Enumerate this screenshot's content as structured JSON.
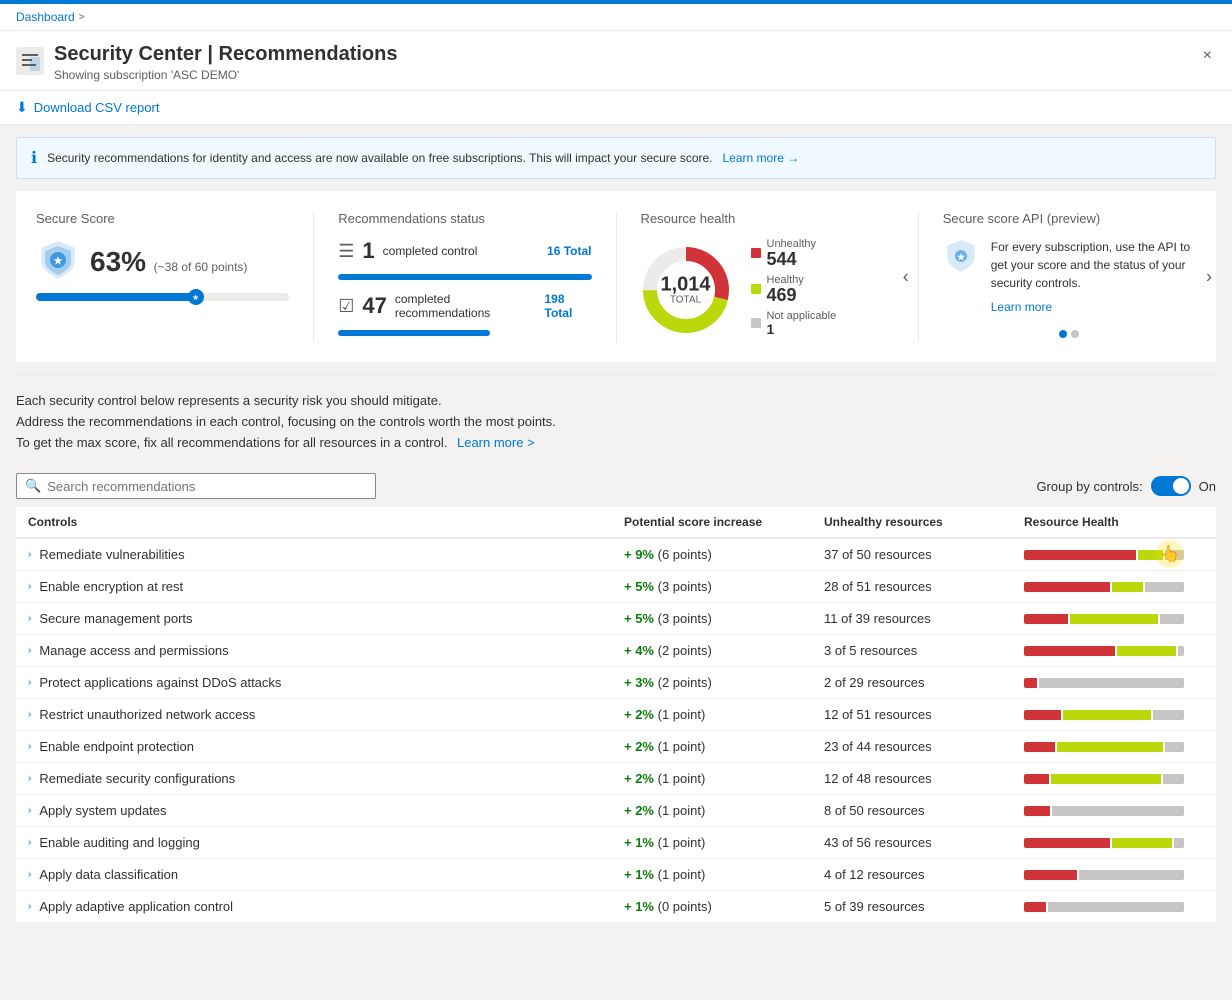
{
  "topbar": {
    "color": "#0078d4"
  },
  "breadcrumb": {
    "items": [
      "Dashboard"
    ],
    "separator": ">"
  },
  "header": {
    "icon_color": "#0078d4",
    "title": "Security Center | Recommendations",
    "subtitle": "Showing subscription 'ASC DEMO'",
    "close_label": "×"
  },
  "toolbar": {
    "download_label": "Download CSV report"
  },
  "info_banner": {
    "text": "Security recommendations for identity and access are now available on free subscriptions. This will impact your secure score.",
    "link_text": "Learn more →"
  },
  "secure_score": {
    "title": "Secure Score",
    "percent": "63%",
    "desc": "(~38 of 60 points)",
    "bar_width": "63"
  },
  "recommendations_status": {
    "title": "Recommendations status",
    "controls_count": "1",
    "controls_label": "completed control",
    "controls_total": "16 Total",
    "recs_count": "47",
    "recs_label": "completed recommendations",
    "recs_total": "198 Total"
  },
  "resource_health": {
    "title": "Resource health",
    "total": "1,014",
    "total_label": "TOTAL",
    "unhealthy_label": "Unhealthy",
    "unhealthy_count": "544",
    "healthy_label": "Healthy",
    "healthy_count": "469",
    "na_label": "Not applicable",
    "na_count": "1",
    "donut": {
      "unhealthy_pct": 54,
      "healthy_pct": 46
    }
  },
  "secure_score_api": {
    "title": "Secure score API (preview)",
    "text": "For every subscription, use the API to get your score and the status of your security controls.",
    "link_text": "Learn more",
    "dots": [
      true,
      false
    ]
  },
  "description": {
    "line1": "Each security control below represents a security risk you should mitigate.",
    "line2": "Address the recommendations in each control, focusing on the controls worth the most points.",
    "line3": "To get the max score, fix all recommendations for all resources in a control.",
    "link_text": "Learn more >"
  },
  "search": {
    "placeholder": "Search recommendations"
  },
  "group_by": {
    "label": "Group by controls:",
    "state": "On"
  },
  "table": {
    "headers": [
      "Controls",
      "Potential score increase",
      "Unhealthy resources",
      "Resource Health"
    ],
    "rows": [
      {
        "name": "Remediate vulnerabilities",
        "score": "+ 9%",
        "score_points": "(6 points)",
        "unhealthy": "37 of 50 resources",
        "red_pct": 72,
        "green_pct": 16,
        "gray_pct": 12,
        "has_cursor": true
      },
      {
        "name": "Enable encryption at rest",
        "score": "+ 5%",
        "score_points": "(3 points)",
        "unhealthy": "28 of 51 resources",
        "red_pct": 55,
        "green_pct": 20,
        "gray_pct": 25,
        "has_cursor": false
      },
      {
        "name": "Secure management ports",
        "score": "+ 5%",
        "score_points": "(3 points)",
        "unhealthy": "11 of 39 resources",
        "red_pct": 28,
        "green_pct": 56,
        "gray_pct": 16,
        "has_cursor": false
      },
      {
        "name": "Manage access and permissions",
        "score": "+ 4%",
        "score_points": "(2 points)",
        "unhealthy": "3 of 5 resources",
        "red_pct": 58,
        "green_pct": 38,
        "gray_pct": 4,
        "has_cursor": false
      },
      {
        "name": "Protect applications against DDoS attacks",
        "score": "+ 3%",
        "score_points": "(2 points)",
        "unhealthy": "2 of 29 resources",
        "red_pct": 8,
        "green_pct": 0,
        "gray_pct": 92,
        "has_cursor": false
      },
      {
        "name": "Restrict unauthorized network access",
        "score": "+ 2%",
        "score_points": "(1 point)",
        "unhealthy": "12 of 51 resources",
        "red_pct": 24,
        "green_pct": 56,
        "gray_pct": 20,
        "has_cursor": false
      },
      {
        "name": "Enable endpoint protection",
        "score": "+ 2%",
        "score_points": "(1 point)",
        "unhealthy": "23 of 44 resources",
        "red_pct": 20,
        "green_pct": 68,
        "gray_pct": 12,
        "has_cursor": false
      },
      {
        "name": "Remediate security configurations",
        "score": "+ 2%",
        "score_points": "(1 point)",
        "unhealthy": "12 of 48 resources",
        "red_pct": 16,
        "green_pct": 70,
        "gray_pct": 14,
        "has_cursor": false
      },
      {
        "name": "Apply system updates",
        "score": "+ 2%",
        "score_points": "(1 point)",
        "unhealthy": "8 of 50 resources",
        "red_pct": 16,
        "green_pct": 0,
        "gray_pct": 84,
        "has_cursor": false
      },
      {
        "name": "Enable auditing and logging",
        "score": "+ 1%",
        "score_points": "(1 point)",
        "unhealthy": "43 of 56 resources",
        "red_pct": 55,
        "green_pct": 39,
        "gray_pct": 6,
        "has_cursor": false
      },
      {
        "name": "Apply data classification",
        "score": "+ 1%",
        "score_points": "(1 point)",
        "unhealthy": "4 of 12 resources",
        "red_pct": 34,
        "green_pct": 0,
        "gray_pct": 66,
        "has_cursor": false
      },
      {
        "name": "Apply adaptive application control",
        "score": "+ 1%",
        "score_points": "(0 points)",
        "unhealthy": "5 of 39 resources",
        "red_pct": 14,
        "green_pct": 0,
        "gray_pct": 86,
        "has_cursor": false
      }
    ]
  }
}
